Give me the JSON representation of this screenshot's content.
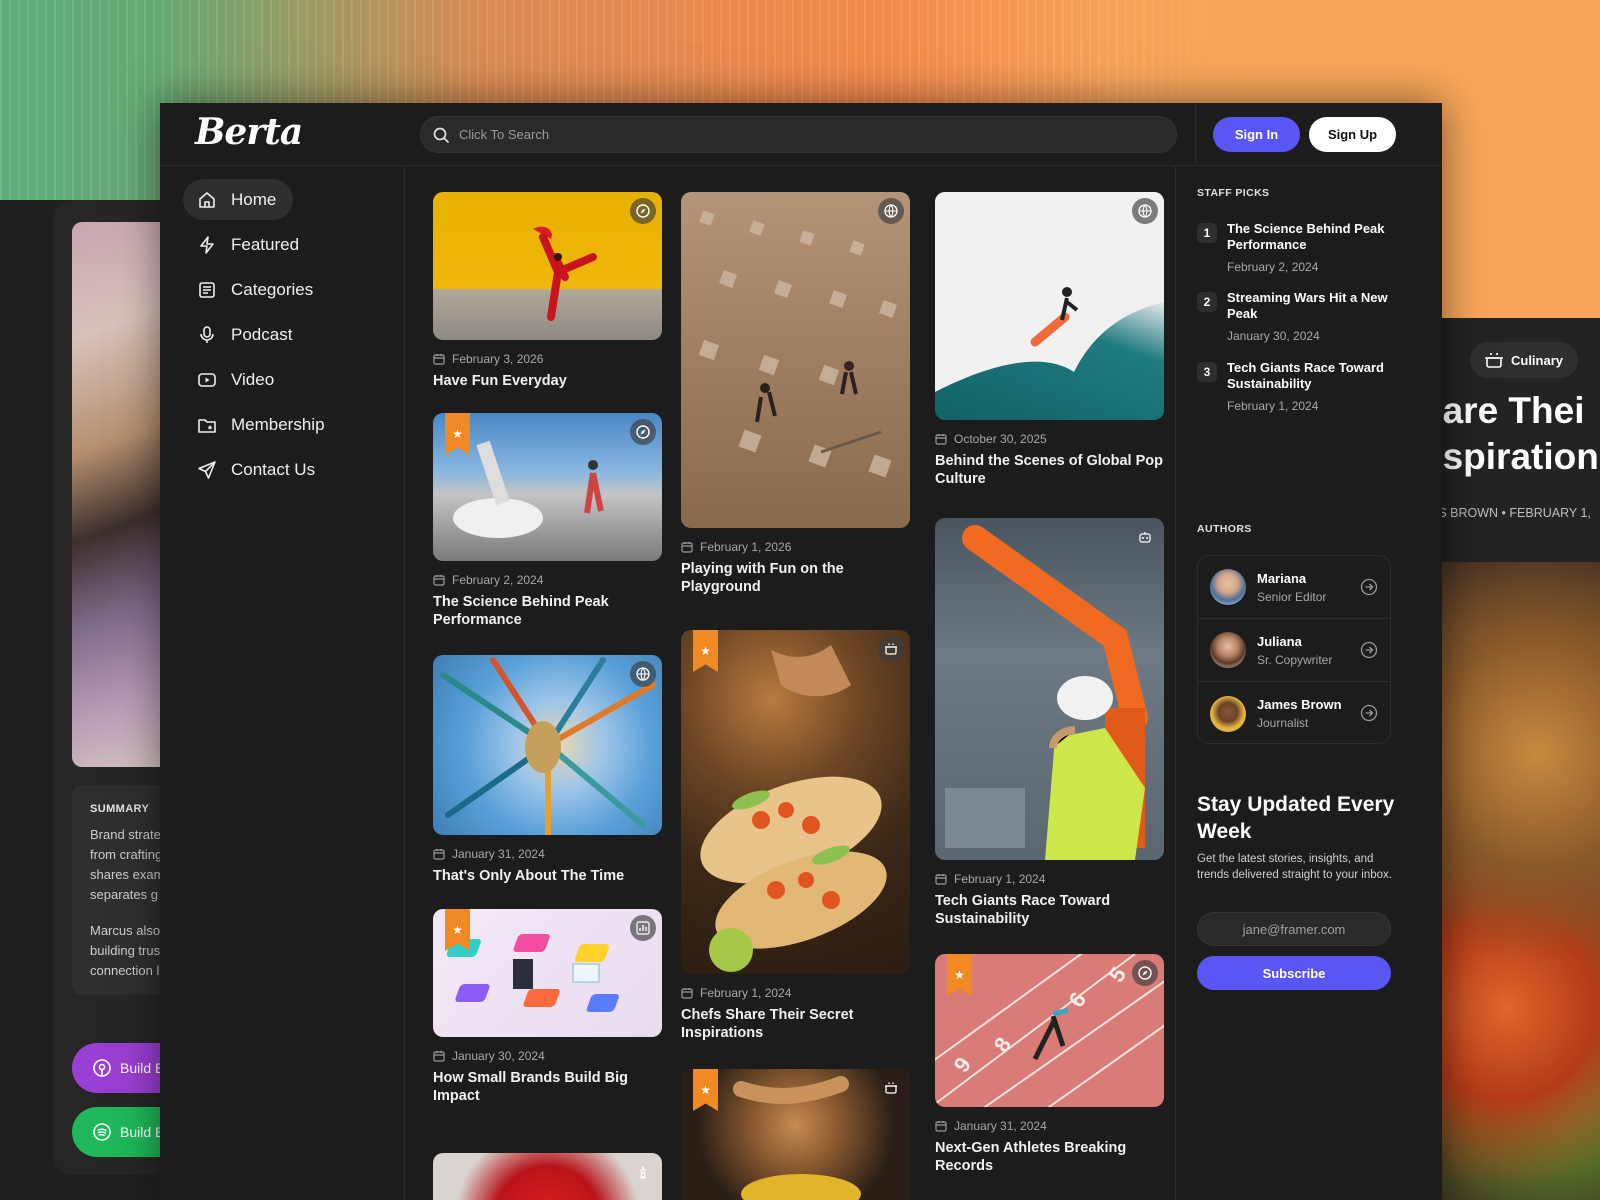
{
  "brand": {
    "logo_text": "Berta"
  },
  "search": {
    "placeholder": "Click To Search"
  },
  "auth": {
    "sign_in": "Sign In",
    "sign_up": "Sign Up"
  },
  "nav": [
    {
      "label": "Home",
      "icon": "home-icon",
      "active": true
    },
    {
      "label": "Featured",
      "icon": "lightning-icon"
    },
    {
      "label": "Categories",
      "icon": "categories-icon"
    },
    {
      "label": "Podcast",
      "icon": "microphone-icon"
    },
    {
      "label": "Video",
      "icon": "video-icon"
    },
    {
      "label": "Membership",
      "icon": "folder-star-icon"
    },
    {
      "label": "Contact Us",
      "icon": "send-icon"
    }
  ],
  "posts": {
    "col1": [
      {
        "date": "February 3, 2026",
        "title": "Have Fun Everyday",
        "category_icon": "compass-icon",
        "featured": false
      },
      {
        "date": "February 2, 2024",
        "title": "The Science Behind Peak Performance",
        "category_icon": "compass-icon",
        "featured": true
      },
      {
        "date": "January 31, 2024",
        "title": "That's Only About The Time",
        "category_icon": "globe-icon",
        "featured": false
      },
      {
        "date": "January 30, 2024",
        "title": "How Small Brands Build Big Impact",
        "category_icon": "chart-icon",
        "featured": true
      },
      {
        "date": "",
        "title": "",
        "category_icon": "chess-icon",
        "featured": false
      }
    ],
    "col2": [
      {
        "date": "February 1, 2026",
        "title": "Playing with Fun on the Playground",
        "category_icon": "globe-icon",
        "featured": false
      },
      {
        "date": "February 1, 2024",
        "title": "Chefs Share Their Secret Inspirations",
        "category_icon": "pot-icon",
        "featured": true
      },
      {
        "date": "",
        "title": "",
        "category_icon": "pot-icon",
        "featured": true
      }
    ],
    "col3": [
      {
        "date": "October 30, 2025",
        "title": "Behind the Scenes of Global Pop Culture",
        "category_icon": "globe-icon",
        "featured": false
      },
      {
        "date": "February 1, 2024",
        "title": "Tech Giants Race Toward Sustainability",
        "category_icon": "robot-icon",
        "featured": false
      },
      {
        "date": "January 31, 2024",
        "title": "Next-Gen Athletes Breaking Records",
        "category_icon": "compass-icon",
        "featured": true
      }
    ]
  },
  "staff_picks": {
    "label": "STAFF PICKS",
    "items": [
      {
        "num": "1",
        "title": "The Science Behind Peak Performance",
        "date": "February 2, 2024"
      },
      {
        "num": "2",
        "title": "Streaming Wars Hit a New Peak",
        "date": "January 30, 2024"
      },
      {
        "num": "3",
        "title": "Tech Giants Race Toward Sustainability",
        "date": "February 1, 2024"
      }
    ]
  },
  "authors": {
    "label": "AUTHORS",
    "items": [
      {
        "name": "Mariana",
        "role": "Senior Editor"
      },
      {
        "name": "Juliana",
        "role": "Sr. Copywriter"
      },
      {
        "name": "James Brown",
        "role": "Journalist"
      }
    ]
  },
  "newsletter": {
    "title": "Stay Updated Every Week",
    "description": "Get the latest stories, insights, and trends delivered straight to your inbox.",
    "placeholder": "jane@framer.com",
    "button": "Subscribe"
  },
  "back_left": {
    "summary_label": "SUMMARY",
    "lines": [
      "Brand strate",
      "from crafting",
      "shares exam",
      "separates g",
      "",
      "Marcus also",
      "building trus",
      "connection l"
    ],
    "pill_purple": "Build B",
    "pill_green": "Build B"
  },
  "back_right": {
    "category": "Culinary",
    "title_line1": "hare Thei",
    "title_line2": "nspiration",
    "byline": "ES BROWN  •  FEBRUARY 1,"
  },
  "colors": {
    "accent": "#5a55f5",
    "featured_flag": "#f08a24",
    "background": "#1c1c1c"
  }
}
